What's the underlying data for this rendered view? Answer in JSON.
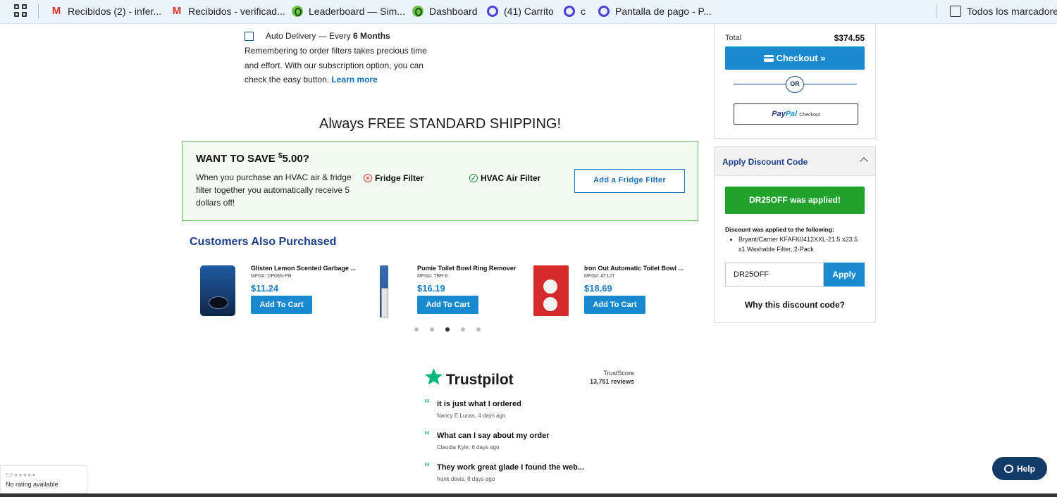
{
  "bookmarks": {
    "items": [
      {
        "label": "Recibidos (2) - infer...",
        "icon": "gmail-icon"
      },
      {
        "label": "Recibidos - verificad...",
        "icon": "gmail-icon"
      },
      {
        "label": "Leaderboard — Sim...",
        "icon": "green-app-icon"
      },
      {
        "label": "Dashboard",
        "icon": "green-app-icon"
      },
      {
        "label": "(41) Carrito",
        "icon": "purple-ring-icon"
      },
      {
        "label": "c",
        "icon": "purple-ring-icon"
      },
      {
        "label": "Pantalla de pago - P...",
        "icon": "purple-ring-icon"
      }
    ],
    "all_bookmarks": "Todos los marcadores"
  },
  "subscription": {
    "label_prefix": "Auto Delivery — Every",
    "frequency": "6 Months",
    "description": "Remembering to order filters takes precious time and effort. With our subscription option, you can check the easy button.",
    "learn_more": "Learn more"
  },
  "shipping_banner": "Always FREE STANDARD SHIPPING!",
  "save_offer": {
    "title_prefix": "WANT TO SAVE",
    "currency": "$",
    "amount": "5.00?",
    "description": "When you purchase an HVAC air & fridge filter together you automatically receive 5 dollars off!",
    "fridge_filter": "Fridge Filter",
    "hvac_filter": "HVAC Air Filter",
    "button": "Add a Fridge Filter"
  },
  "customers_also_purchased": {
    "title": "Customers Also Purchased",
    "products": [
      {
        "name": "Glisten Lemon Scented Garbage ...",
        "mfg": "MFG#: DP06N-PB",
        "price": "$11.24",
        "button": "Add To Cart"
      },
      {
        "name": "Pumie Toilet Bowl Ring Remover",
        "mfg": "MFG#: TBR-6",
        "price": "$16.19",
        "button": "Add To Cart"
      },
      {
        "name": "Iron Out Automatic Toilet Bowl ...",
        "mfg": "MFG#: AT12T",
        "price": "$18.69",
        "button": "Add To Cart"
      }
    ],
    "carousel_active_index": 2,
    "carousel_count": 5
  },
  "trustpilot": {
    "brand": "Trustpilot",
    "score_label": "TrustScore",
    "reviews_count": "13,751 reviews",
    "reviews": [
      {
        "text": "it is just what I ordered",
        "meta": "Nancy E Lucas, 4 days ago"
      },
      {
        "text": "What can I say about my order",
        "meta": "Claudia Kyle, 6 days ago"
      },
      {
        "text": "They work great glade I found the web...",
        "meta": "frank davis, 8 days ago"
      }
    ]
  },
  "order_summary": {
    "total_label": "Total",
    "total_value": "$374.55",
    "checkout_button": "Checkout »",
    "or_label": "OR",
    "paypal_pay": "Pay",
    "paypal_pal": "Pal",
    "paypal_checkout": "Checkout"
  },
  "discount": {
    "title": "Apply Discount Code",
    "applied_message": "DR25OFF was applied!",
    "applied_to_label": "Discount was applied to the following:",
    "applied_items": [
      "Bryant/Carrier KFAFK0412XXL-21.5 x23.5 x1 Washable Filter, 2-Pack"
    ],
    "code_value": "DR25OFF",
    "apply_button": "Apply",
    "why_link": "Why this discount code?"
  },
  "rating_widget": {
    "stars": "0.0 ★★★★★",
    "text": "No rating available"
  },
  "help_button": "Help",
  "colors": {
    "accent_blue": "#1a8ad0",
    "nav_blue": "#1d3f8a",
    "success_green": "#1fa32c",
    "trustpilot_green": "#00b67a"
  }
}
